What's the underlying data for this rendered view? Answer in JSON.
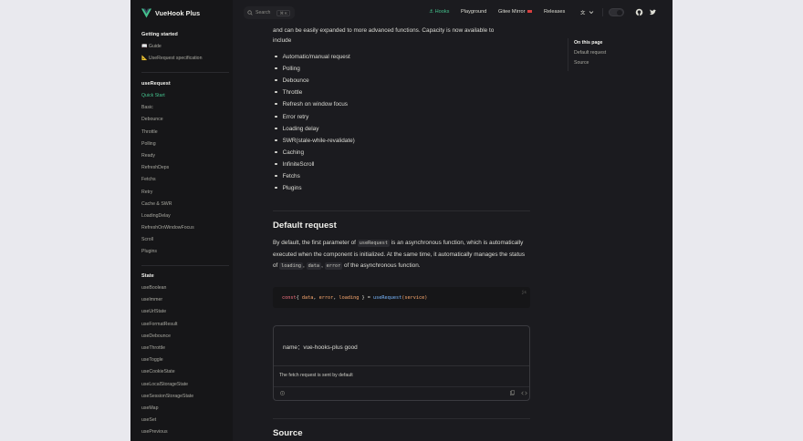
{
  "brand": {
    "title": "VueHook Plus",
    "brand_color": "#44c08c"
  },
  "search": {
    "placeholder": "Search",
    "shortcut": "⌘ K"
  },
  "topnav": {
    "hooks": "Hooks",
    "playground": "Playground",
    "gitee": "Gitee Mirror",
    "releases": "Releases"
  },
  "sidebar": {
    "getting_started": {
      "title": "Getting started",
      "items": [
        "Guide",
        "UseRequest specification"
      ]
    },
    "use_request": {
      "title": "useRequest",
      "items": [
        "Quick Start",
        "Basic",
        "Debounce",
        "Throttle",
        "Polling",
        "Ready",
        "RefreshDeps",
        "Fetchs",
        "Retry",
        "Cache & SWR",
        "LoadingDelay",
        "RefreshOnWindowFocus",
        "Scroll",
        "Plugins"
      ]
    },
    "state": {
      "title": "State",
      "items": [
        "useBoolean",
        "useImmer",
        "useUrlState",
        "useFormatResult",
        "useDebounce",
        "useThrottle",
        "useToggle",
        "useCookieState",
        "useLocalStorageState",
        "useSessionStorageState",
        "useMap",
        "useSet",
        "usePrevious"
      ]
    }
  },
  "content": {
    "intro_line1": "and can be easily expanded to more advanced functions. Capacity is now available to",
    "intro_line2": "include",
    "features": [
      "Automatic/manual request",
      "Polling",
      "Debounce",
      "Throttle",
      "Refresh on window focus",
      "Error retry",
      "Loading delay",
      "SWR(stale-while-revalidate)",
      "Caching",
      "InfiniteScroll",
      "Fetchs",
      "Plugins"
    ],
    "default_request_heading": "Default request",
    "para": {
      "t1": "By default, the first parameter of",
      "c1": "useRequest",
      "t2": "is an asynchronous function, which is automatically executed when the component is initialized. At the same time, it automatically manages the status of",
      "c2": "loading",
      "sep1": ",",
      "c3": "data",
      "sep2": ",",
      "c4": "error",
      "t3": "of the asynchronous function."
    },
    "code": {
      "lang": "js",
      "t_const": "const",
      "t_open": "{ ",
      "t_data": "data",
      "t_comma1": ", ",
      "t_error": "error",
      "t_comma2": ", ",
      "t_loading": "loading",
      "t_close": " } = ",
      "t_fn": "useRequest",
      "t_args": "(service)"
    },
    "demo": {
      "result": "name：vue-hooks-plus good",
      "desc": "The fetch request is sent by default"
    },
    "source_heading": "Source"
  },
  "aside": {
    "title": "On this page",
    "links": [
      "Default request",
      "Source"
    ]
  }
}
